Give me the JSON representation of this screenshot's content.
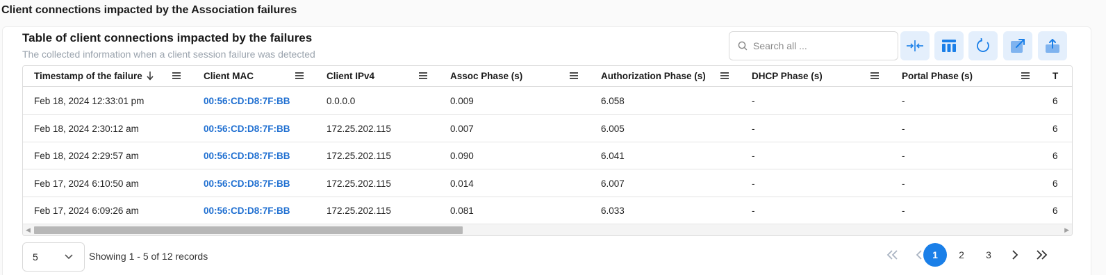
{
  "page": {
    "title": "Client connections impacted by the Association failures"
  },
  "card": {
    "title": "Table of client connections impacted by the failures",
    "subtitle": "The collected information when a client session failure was detected"
  },
  "search": {
    "placeholder": "Search all ...",
    "icon": "search-icon"
  },
  "toolbar": {
    "buttons": [
      {
        "name": "fit-columns-button",
        "icon": "fit-columns-icon"
      },
      {
        "name": "column-chooser-button",
        "icon": "columns-icon"
      },
      {
        "name": "refresh-button",
        "icon": "refresh-icon"
      },
      {
        "name": "open-external-button",
        "icon": "external-link-icon"
      },
      {
        "name": "export-button",
        "icon": "upload-icon"
      }
    ],
    "accent": "#1a7fe8",
    "button_bg": "#e4effc"
  },
  "table": {
    "columns": [
      {
        "label": "Timestamp of the failure",
        "sorted": "desc"
      },
      {
        "label": "Client MAC"
      },
      {
        "label": "Client IPv4"
      },
      {
        "label": "Assoc Phase (s)"
      },
      {
        "label": "Authorization Phase (s)"
      },
      {
        "label": "DHCP Phase (s)"
      },
      {
        "label": "Portal Phase (s)"
      },
      {
        "label": "T"
      }
    ],
    "rows": [
      {
        "timestamp": "Feb 18, 2024 12:33:01 pm",
        "mac": "00:56:CD:D8:7F:BB",
        "ipv4": "0.0.0.0",
        "assoc": "0.009",
        "auth": "6.058",
        "dhcp": "-",
        "portal": "-",
        "trunc": "6"
      },
      {
        "timestamp": "Feb 18, 2024 2:30:12 am",
        "mac": "00:56:CD:D8:7F:BB",
        "ipv4": "172.25.202.115",
        "assoc": "0.007",
        "auth": "6.005",
        "dhcp": "-",
        "portal": "-",
        "trunc": "6"
      },
      {
        "timestamp": "Feb 18, 2024 2:29:57 am",
        "mac": "00:56:CD:D8:7F:BB",
        "ipv4": "172.25.202.115",
        "assoc": "0.090",
        "auth": "6.041",
        "dhcp": "-",
        "portal": "-",
        "trunc": "6"
      },
      {
        "timestamp": "Feb 17, 2024 6:10:50 am",
        "mac": "00:56:CD:D8:7F:BB",
        "ipv4": "172.25.202.115",
        "assoc": "0.014",
        "auth": "6.007",
        "dhcp": "-",
        "portal": "-",
        "trunc": "6"
      },
      {
        "timestamp": "Feb 17, 2024 6:09:26 am",
        "mac": "00:56:CD:D8:7F:BB",
        "ipv4": "172.25.202.115",
        "assoc": "0.081",
        "auth": "6.033",
        "dhcp": "-",
        "portal": "-",
        "trunc": "6"
      }
    ],
    "link_color": "#1f6fd1"
  },
  "footer": {
    "page_size": "5",
    "showing": "Showing 1 - 5 of 12 records",
    "pages": [
      "1",
      "2",
      "3"
    ],
    "current_page": "1"
  }
}
